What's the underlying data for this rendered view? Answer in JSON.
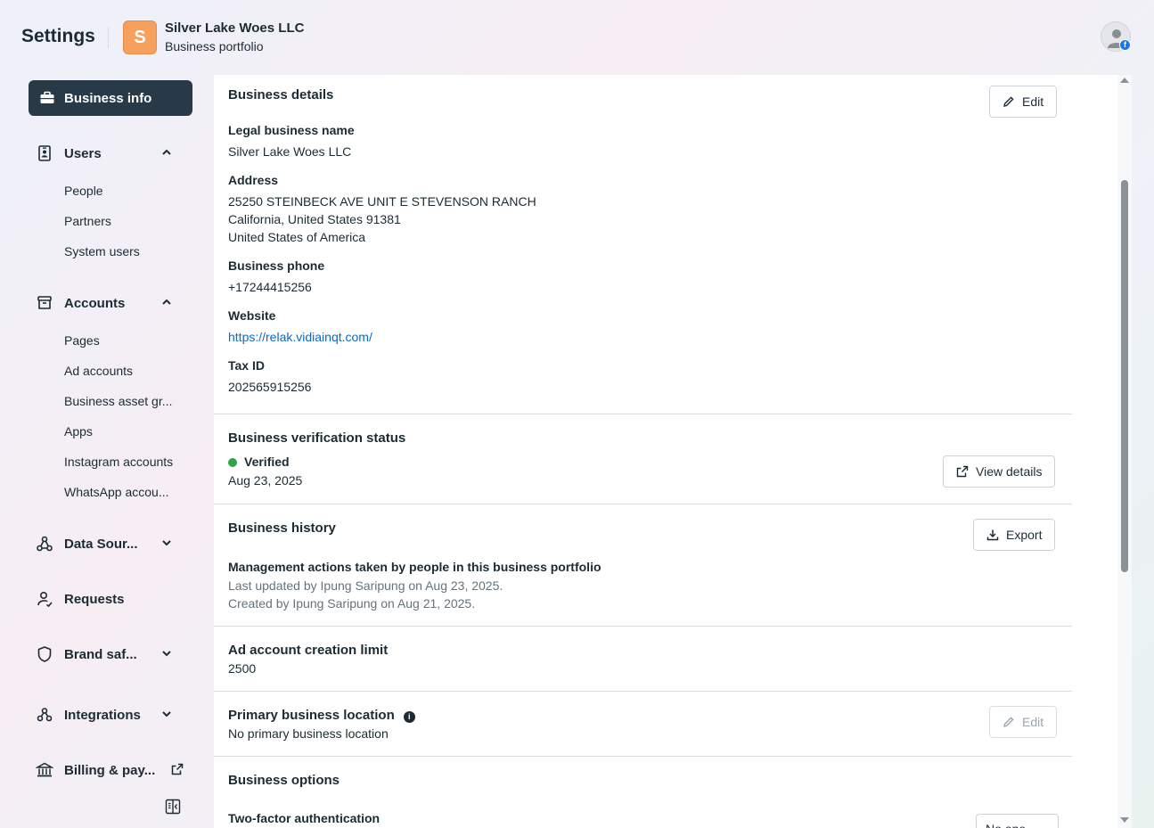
{
  "header": {
    "title": "Settings",
    "business_initial": "S",
    "business_name": "Silver Lake Woes LLC",
    "business_subtitle": "Business portfolio",
    "badge_glyph": "f"
  },
  "sidebar": {
    "active": {
      "label": "Business info",
      "icon": "briefcase-icon"
    },
    "groups": [
      {
        "label": "Users",
        "icon": "id-badge-icon",
        "expanded": true,
        "items": [
          "People",
          "Partners",
          "System users"
        ]
      },
      {
        "label": "Accounts",
        "icon": "archive-box-icon",
        "expanded": true,
        "items": [
          "Pages",
          "Ad accounts",
          "Business asset gr...",
          "Apps",
          "Instagram accounts",
          "WhatsApp accou..."
        ]
      },
      {
        "label": "Data Sour...",
        "icon": "data-sources-icon",
        "expanded": false
      },
      {
        "label": "Requests",
        "icon": "person-request-icon"
      },
      {
        "label": "Brand saf...",
        "icon": "shield-icon",
        "expanded": false
      },
      {
        "label": "Integrations",
        "icon": "integrations-icon",
        "expanded": false
      },
      {
        "label": "Billing & pay...",
        "icon": "bank-icon",
        "external": true
      }
    ]
  },
  "business_details": {
    "title": "Business details",
    "edit_label": "Edit",
    "legal_name_label": "Legal business name",
    "legal_name": "Silver Lake Woes LLC",
    "address_label": "Address",
    "address_line1": "25250 STEINBECK AVE UNIT E STEVENSON RANCH",
    "address_line2": "California, United States 91381",
    "address_line3": "United States of America",
    "phone_label": "Business phone",
    "phone": "+17244415256",
    "website_label": "Website",
    "website": "https://relak.vidiainqt.com/",
    "tax_label": "Tax ID",
    "tax_id": "202565915256"
  },
  "verification": {
    "title": "Business verification status",
    "status": "Verified",
    "status_color": "#31a24c",
    "date": "Aug 23, 2025",
    "button_label": "View details"
  },
  "history": {
    "title": "Business history",
    "button_label": "Export",
    "subtitle": "Management actions taken by people in this business portfolio",
    "updated": "Last updated by Ipung Saripung on Aug 23, 2025.",
    "created": "Created by Ipung Saripung on Aug 21, 2025."
  },
  "ad_limit": {
    "title": "Ad account creation limit",
    "value": "2500"
  },
  "location": {
    "title": "Primary business location",
    "info_glyph": "i",
    "value": "No primary business location",
    "edit_label": "Edit"
  },
  "options": {
    "title": "Business options",
    "two_factor_label": "Two-factor authentication",
    "two_factor_value": "No one"
  },
  "colors": {
    "active_nav_bg": "#283a48",
    "link": "#0a6ac4",
    "avatar": "#f5a05c"
  }
}
